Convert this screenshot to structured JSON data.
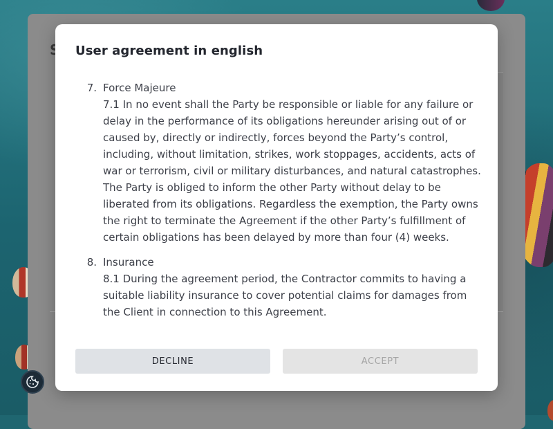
{
  "background_page": {
    "title_peek": "S"
  },
  "modal": {
    "title": "User agreement in english",
    "clauses": [
      {
        "number": "7.",
        "heading": "Force Majeure",
        "text": "7.1 In no event shall the Party be responsible or liable for any failure or delay in the performance of its obligations hereunder arising out of or caused by, directly or indirectly, forces beyond the Party’s control, including, without limitation, strikes, work stoppages, accidents, acts of war or terrorism, civil or military disturbances, and natural catastrophes. The Party is obliged to inform the other Party without delay to be liberated from its obligations. Regardless the exemption, the Party owns the right to terminate the Agreement if the other Party’s fulfillment of certain obligations has been delayed by more than four (4) weeks."
      },
      {
        "number": "8.",
        "heading": "Insurance",
        "text": "8.1 During the agreement period, the Contractor commits to having a suitable liability insurance to cover potential claims for damages from the Client in connection to this Agreement."
      }
    ],
    "buttons": {
      "decline": "DECLINE",
      "accept": "ACCEPT"
    }
  },
  "cookie_button": {
    "icon": "cookie-icon"
  },
  "colors": {
    "modal_bg": "#ffffff",
    "decline_bg": "#dfe2e6",
    "accept_bg_disabled": "#e4e4e4",
    "accept_text_disabled": "#a5a5a5",
    "text": "#3d4049"
  }
}
